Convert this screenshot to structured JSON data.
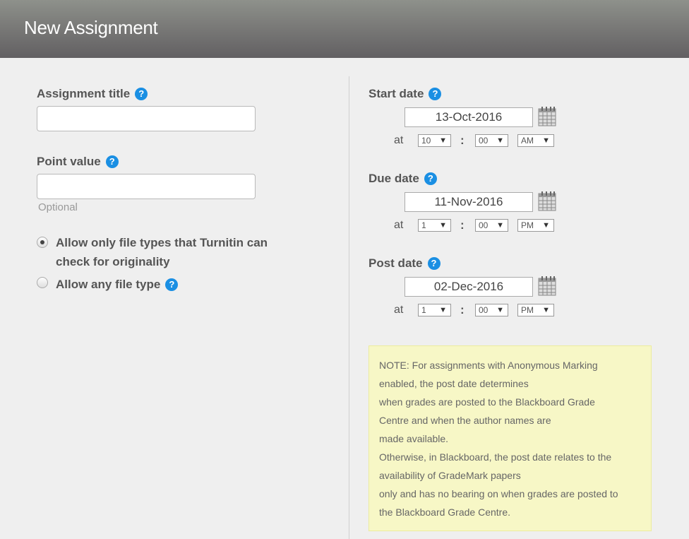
{
  "header": {
    "title": "New Assignment"
  },
  "left": {
    "assignment_title_label": "Assignment title",
    "assignment_title_value": "",
    "point_value_label": "Point value",
    "point_value_value": "",
    "point_value_hint": "Optional",
    "option_turnitin_line1": "Allow only file types that Turnitin can",
    "option_turnitin_line2": "check for originality",
    "option_any_label": "Allow any file type",
    "selected_option": "turnitin"
  },
  "help_glyph": "?",
  "at_label": "at",
  "colon": ":",
  "dates": {
    "start": {
      "label": "Start date",
      "date": "13-Oct-2016",
      "hour": "10",
      "minute": "00",
      "ampm": "AM"
    },
    "due": {
      "label": "Due date",
      "date": "11-Nov-2016",
      "hour": "1",
      "minute": "00",
      "ampm": "PM"
    },
    "post": {
      "label": "Post date",
      "date": "02-Dec-2016",
      "hour": "1",
      "minute": "00",
      "ampm": "PM"
    }
  },
  "note": {
    "lines": [
      "NOTE: For assignments with Anonymous Marking",
      "enabled, the post date determines",
      "when grades are posted to the Blackboard Grade",
      "Centre and when the author names are",
      "made available.",
      "Otherwise, in Blackboard, the post date relates to the",
      "availability of GradeMark papers",
      "only and has no bearing on when grades are posted to",
      "the Blackboard Grade Centre."
    ]
  },
  "colors": {
    "help_icon": "#1a8fe3",
    "note_bg": "#f7f7c6",
    "header_top": "#8e918b",
    "header_bottom": "#626062"
  }
}
